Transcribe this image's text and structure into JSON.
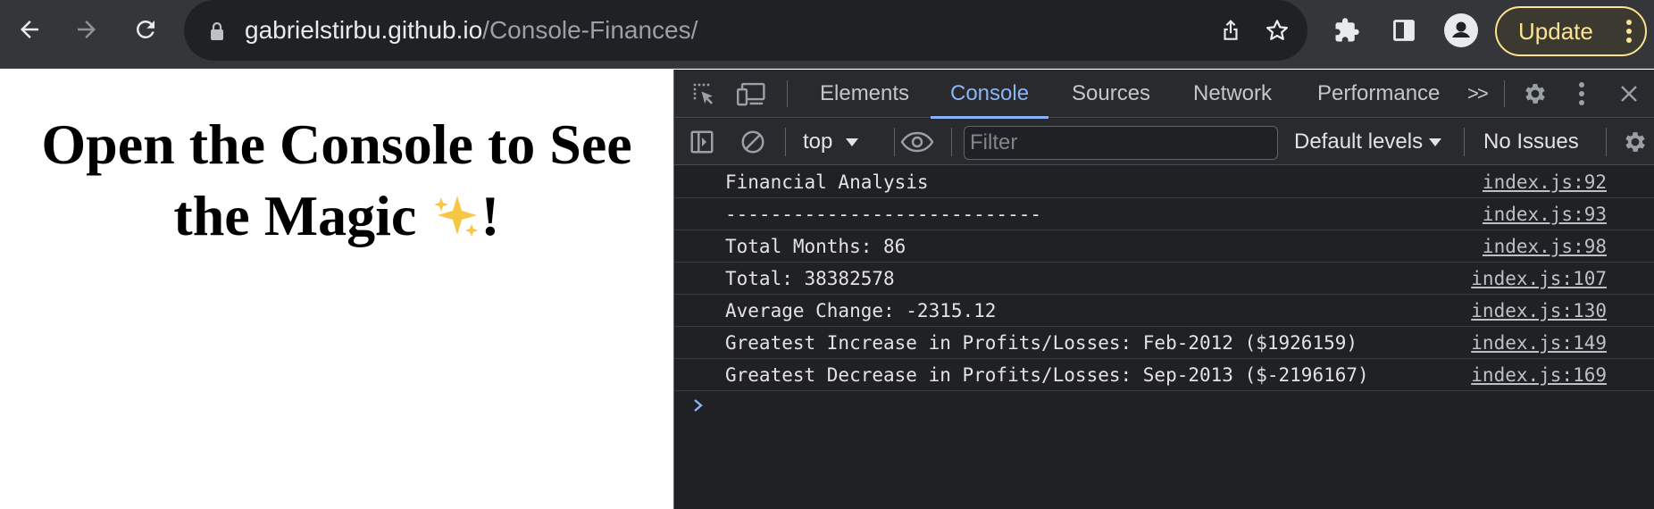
{
  "browser": {
    "url_host": "gabrielstirbu.github.io",
    "url_path": "/Console-Finances/",
    "update_label": "Update",
    "icons": {
      "back": "arrow-left-icon",
      "forward": "arrow-right-icon",
      "reload": "reload-icon",
      "lock": "lock-icon",
      "share": "share-icon",
      "bookmark": "star-icon",
      "extensions": "puzzle-icon",
      "side_panel": "side-panel-icon",
      "profile": "person-icon",
      "menu": "vertical-dots-icon"
    },
    "colors": {
      "toolbar_bg": "#35363a",
      "omnibox_bg": "#202124",
      "update_accent": "#fde293"
    }
  },
  "page": {
    "heading_text": "Open the Console to See the Magic ",
    "heading_emoji": "✨",
    "heading_end": "!"
  },
  "devtools": {
    "tabs": [
      {
        "label": "Elements",
        "active": false
      },
      {
        "label": "Console",
        "active": true
      },
      {
        "label": "Sources",
        "active": false
      },
      {
        "label": "Network",
        "active": false
      },
      {
        "label": "Performance",
        "active": false
      }
    ],
    "more_tabs_label": ">>",
    "console_toolbar": {
      "context": "top",
      "filter_placeholder": "Filter",
      "levels": "Default levels",
      "issues": "No Issues"
    },
    "logs": [
      {
        "message": "Financial Analysis",
        "source": "index.js:92"
      },
      {
        "message": "----------------------------",
        "source": "index.js:93"
      },
      {
        "message": "Total Months: 86",
        "source": "index.js:98"
      },
      {
        "message": "Total: 38382578",
        "source": "index.js:107"
      },
      {
        "message": "Average Change: -2315.12",
        "source": "index.js:130"
      },
      {
        "message": "Greatest Increase in Profits/Losses: Feb-2012 ($1926159)",
        "source": "index.js:149"
      },
      {
        "message": "Greatest Decrease in Profits/Losses: Sep-2013 ($-2196167)",
        "source": "index.js:169"
      }
    ],
    "colors": {
      "bg": "#202124",
      "accent": "#8ab4f8",
      "text": "#e3e3e3"
    }
  }
}
